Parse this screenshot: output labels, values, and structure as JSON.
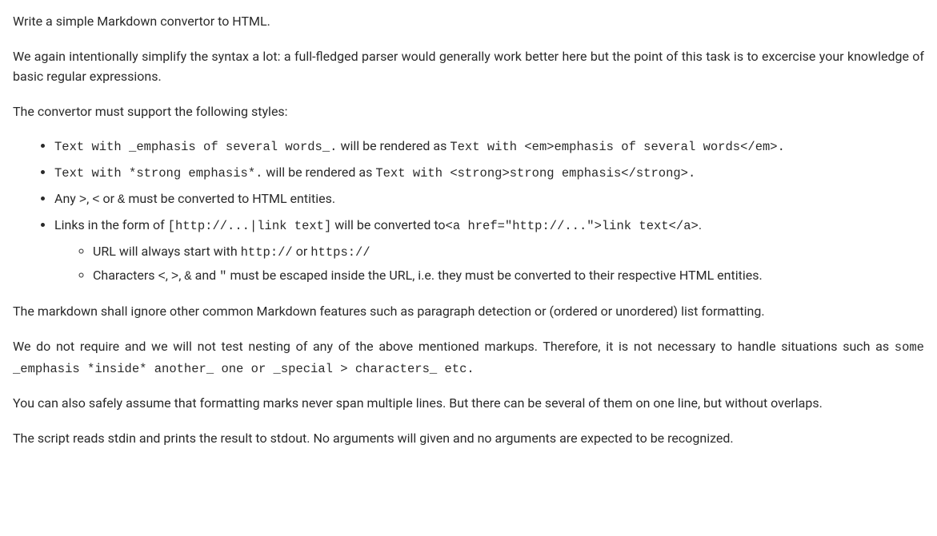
{
  "p1": "Write a simple Markdown convertor to HTML.",
  "p2": "We again intentionally simplify the syntax a lot: a full-fledged parser would generally work better here but the point of this task is to excercise your knowledge of basic regular expressions.",
  "p3": "The convertor must support the following styles:",
  "li1": {
    "code1": "Text with _emphasis of several words_.",
    "mid": " will be rendered as ",
    "code2": "Text with <em>emphasis of several words</em>."
  },
  "li2": {
    "code1": "Text with *strong emphasis*.",
    "mid": " will be rendered as ",
    "code2": "Text with <strong>strong emphasis</strong>."
  },
  "li3": {
    "a": "Any ",
    "c1": ">",
    "b": ", ",
    "c2": "<",
    "c": " or ",
    "c3": "&",
    "d": " must be converted to HTML entities."
  },
  "li4": {
    "a": "Links in the form of ",
    "c1": "[http://...|link text]",
    "b": " will be converted to",
    "c2": "<a href=\"http://...\">link text</a>",
    "c": "."
  },
  "li4_1": {
    "a": "URL will always start with ",
    "c1": "http://",
    "b": " or ",
    "c2": "https://"
  },
  "li4_2": {
    "a": "Characters ",
    "c1": "<",
    "b": ", ",
    "c2": ">",
    "c": ", ",
    "c3": "&",
    "d": " and ",
    "c4": "\"",
    "e": " must be escaped inside the URL, i.e. they must be converted to their respective HTML entities."
  },
  "p4": "The markdown shall ignore other common Markdown features such as paragraph detection or (ordered or unordered) list formatting.",
  "p5": {
    "a": "We do not require and we will not test nesting of any of the above mentioned markups. Therefore, it is not necessary to handle situations such as ",
    "c1": "some _emphasis *inside* another_ one or _special > characters_ etc."
  },
  "p6": "You can also safely assume that formatting marks never span multiple lines. But there can be several of them on one line, but without overlaps.",
  "p7": "The script reads stdin and prints the result to stdout. No arguments will given and no arguments are expected to be recognized."
}
